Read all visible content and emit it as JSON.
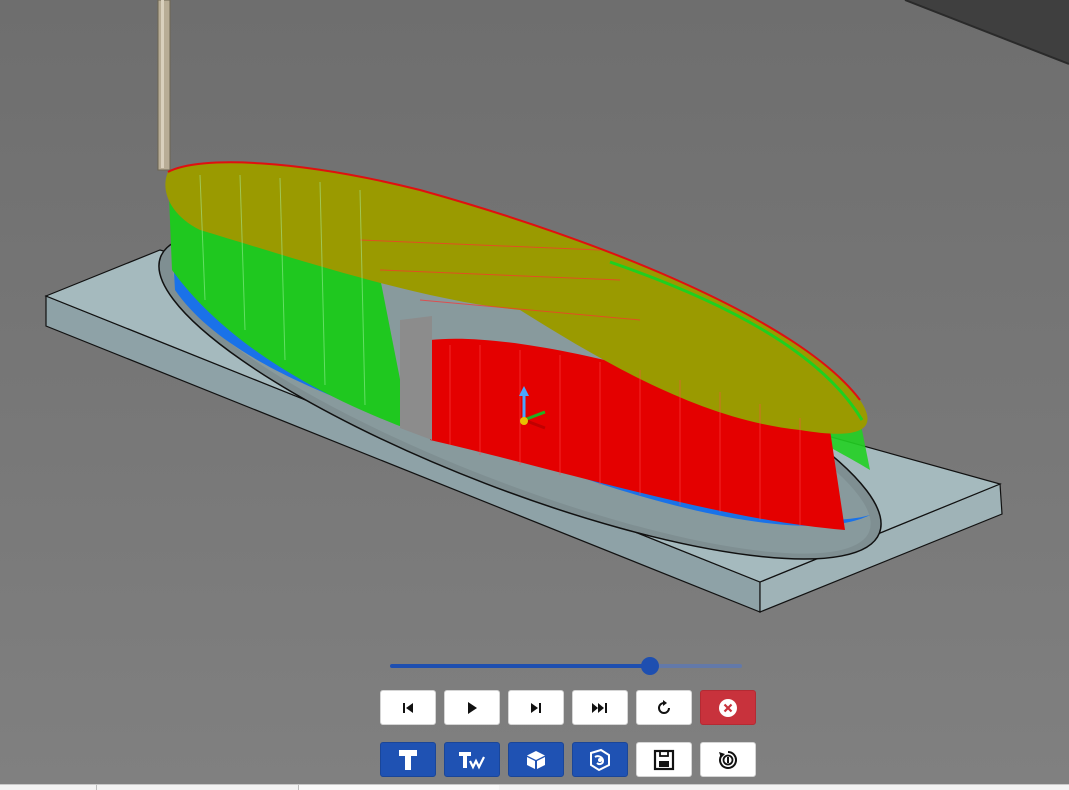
{
  "colors": {
    "background": "#767676",
    "stock_top": "#a3b8bc",
    "stock_side": "#93aaaf",
    "toolpath_top": "#9a9a00",
    "toolpath_green": "#22d022",
    "toolpath_red": "#e00000",
    "toolpath_blue": "#1a72e8",
    "accent_blue": "#1f52b3",
    "danger_red": "#c8323c"
  },
  "simulation": {
    "progress": 0.74
  },
  "playback_toolbar": {
    "buttons": [
      {
        "name": "skip-to-start-button",
        "icon": "skip-start-icon",
        "style": "white"
      },
      {
        "name": "play-button",
        "icon": "play-icon",
        "style": "white"
      },
      {
        "name": "step-forward-button",
        "icon": "step-forward-icon",
        "style": "white"
      },
      {
        "name": "skip-to-end-button",
        "icon": "fast-forward-icon",
        "style": "white"
      },
      {
        "name": "reset-button",
        "icon": "rotate-icon",
        "style": "white"
      },
      {
        "name": "close-simulation-button",
        "icon": "close-icon",
        "style": "red"
      }
    ]
  },
  "view_toolbar": {
    "buttons": [
      {
        "name": "show-tool-button",
        "icon": "tool-icon",
        "style": "blue"
      },
      {
        "name": "show-toolpath-button",
        "icon": "toolpath-icon",
        "style": "blue"
      },
      {
        "name": "show-stock-button",
        "icon": "stock-cube-icon",
        "style": "blue"
      },
      {
        "name": "show-model-button",
        "icon": "model-icon",
        "style": "blue"
      },
      {
        "name": "save-button",
        "icon": "save-icon",
        "style": "white"
      },
      {
        "name": "rapid-moves-button",
        "icon": "rapid-moves-icon",
        "style": "white"
      }
    ]
  }
}
